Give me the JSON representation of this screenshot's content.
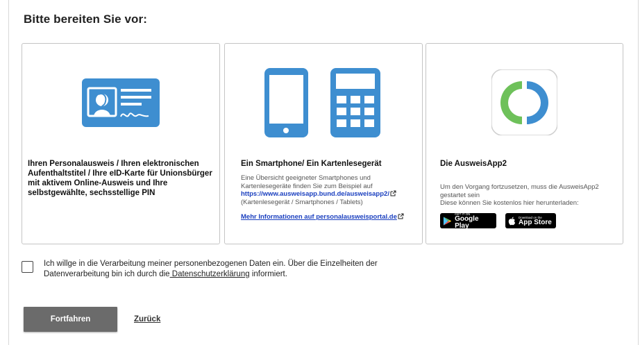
{
  "heading": "Bitte bereiten Sie vor:",
  "cards": [
    {
      "icon": "id-card-icon",
      "title": "Ihren Personalausweis / Ihren elektronischen Aufenthaltstitel / Ihre eID-Karte für Unionsbürger mit aktivem Online-Ausweis und Ihre selbstgewählte, sechsstellige PIN"
    },
    {
      "icon": "smartphone-card-reader-icon",
      "title": "Ein Smartphone/ Ein Kartenlesegerät",
      "text_intro": "Eine Übersicht geeigneter Smartphones und Kartenlesegeräte finden Sie zum Beispiel auf",
      "link_url_text": "https://www.ausweisapp.bund.de/ausweisapp2/",
      "text_after": "(Kartenlesegerät / Smartphones / Tablets)",
      "more_link": "Mehr Informationen auf personalausweisportal.de"
    },
    {
      "icon": "ausweisapp-logo-icon",
      "title": "Die AusweisApp2",
      "text_1": "Um den Vorgang fortzusetzen, muss die AusweisApp2 gestartet sein",
      "text_2": "Diese können Sie kostenlos hier herunterladen:",
      "google_small": "GET IT ON",
      "google_big": "Google Play",
      "apple_small": "Download on the",
      "apple_big": "App Store"
    }
  ],
  "consent": {
    "text_before": "Ich willge in die Verarbeitung meiner personenbezogenen Daten ein. Über die Einzelheiten der Datenverarbeitung bin ich durch die",
    "link": " Datenschutzerklärung",
    "text_after": " informiert.",
    "checked": false
  },
  "actions": {
    "continue_label": "Fortfahren",
    "back_label": "Zurück"
  },
  "colors": {
    "accent_blue": "#3e8ed0",
    "link_blue": "#1a3fbf",
    "button_gray": "#6b6b6b",
    "logo_green": "#6ec15a"
  }
}
